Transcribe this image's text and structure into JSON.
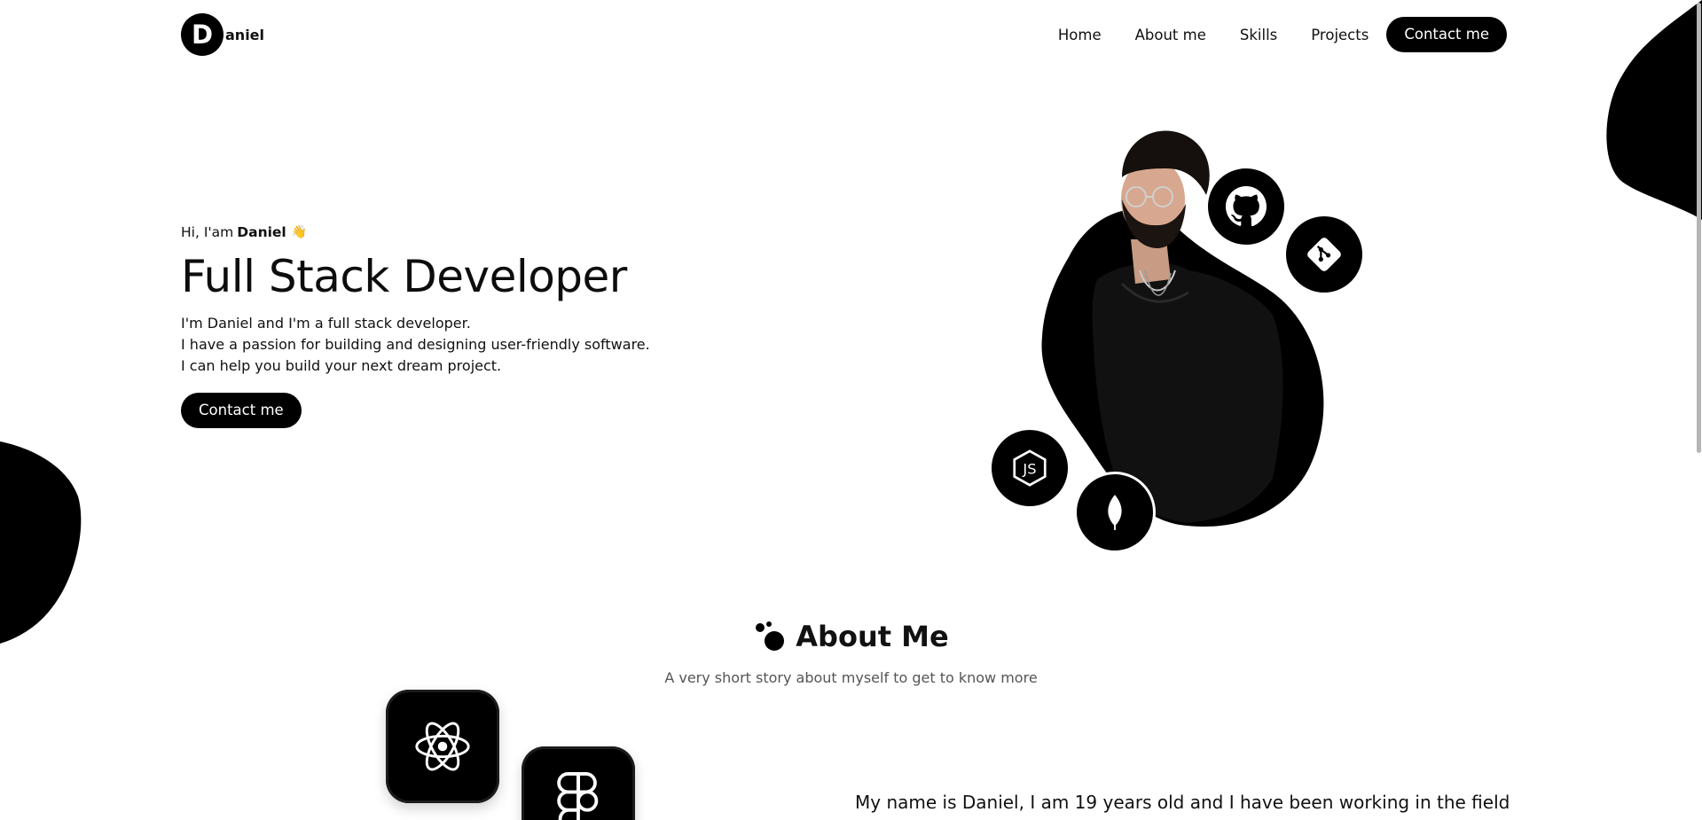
{
  "brand": {
    "initial": "D",
    "name": "aniel"
  },
  "nav": {
    "items": [
      "Home",
      "About me",
      "Skills",
      "Projects"
    ],
    "cta": "Contact me"
  },
  "hero": {
    "greeting_prefix": "Hi, I'am",
    "greeting_name": "Daniel",
    "wave": "👋",
    "title": "Full Stack Developer",
    "desc_lines": [
      "I'm Daniel and I'm a full stack developer.",
      "I have a passion for building and designing user-friendly software.",
      "I can help you build your next dream project."
    ],
    "cta": "Contact me",
    "badges": [
      "github-icon",
      "git-icon",
      "nodejs-icon",
      "mongodb-icon"
    ]
  },
  "about": {
    "title": "About Me",
    "subtitle": "A very short story about myself to get to know more",
    "tiles": [
      "react-icon",
      "figma-icon"
    ],
    "body": "My name is Daniel, I am 19 years old and I have been working in the field"
  },
  "colors": {
    "primary": "#000000",
    "background": "#ffffff",
    "muted": "#555555"
  }
}
